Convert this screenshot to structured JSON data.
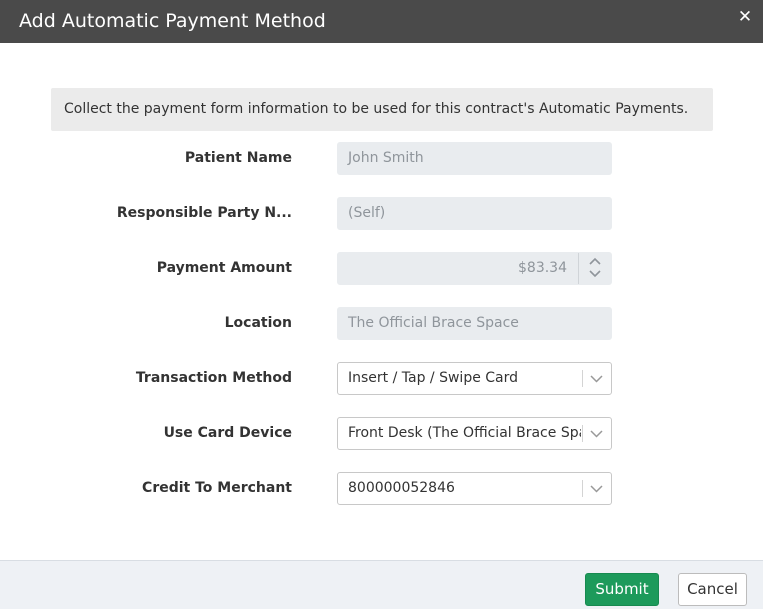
{
  "dialog": {
    "title": "Add Automatic Payment Method",
    "close_glyph": "✕",
    "info": "Collect the payment form information to be used for this contract's Automatic Payments."
  },
  "form": {
    "patient_name": {
      "label": "Patient Name",
      "value": "John Smith"
    },
    "responsible_party": {
      "label": "Responsible Party N...",
      "value": "(Self)"
    },
    "payment_amount": {
      "label": "Payment Amount",
      "value": "$83.34"
    },
    "location": {
      "label": "Location",
      "value": "The Official Brace Space"
    },
    "transaction_method": {
      "label": "Transaction Method",
      "value": "Insert / Tap / Swipe Card"
    },
    "card_device": {
      "label": "Use Card Device",
      "value": "Front Desk (The Official Brace Space)"
    },
    "credit_merchant": {
      "label": "Credit To Merchant",
      "value": "800000052846"
    }
  },
  "footer": {
    "submit_label": "Submit",
    "cancel_label": "Cancel"
  },
  "colors": {
    "titlebar": "#4a4a4a",
    "submit": "#1d9a5b",
    "footer": "#eef1f5"
  },
  "icons": {
    "close": "close-icon",
    "chevron": "chevron-down-icon",
    "spin_up": "chevron-up-icon",
    "spin_down": "chevron-down-icon"
  }
}
